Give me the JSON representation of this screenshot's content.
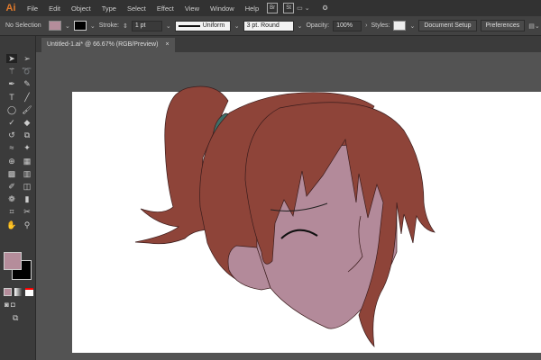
{
  "app": {
    "logo": "Ai",
    "menus": [
      "File",
      "Edit",
      "Object",
      "Type",
      "Select",
      "Effect",
      "View",
      "Window",
      "Help"
    ],
    "bridge": "Br",
    "stock": "St"
  },
  "control": {
    "selection": "No Selection",
    "fill_color": "#b58d9b",
    "stroke_label": "Stroke:",
    "stroke_weight": "1 pt",
    "profile": "Uniform",
    "brush": "3 pt. Round",
    "opacity_label": "Opacity:",
    "opacity": "100%",
    "styles_label": "Styles:",
    "document_setup": "Document Setup",
    "preferences": "Preferences"
  },
  "document": {
    "tab_title": "Untitled-1.ai* @ 66.67% (RGB/Preview)",
    "close": "×"
  },
  "colors": {
    "hair": "#8e4439",
    "skin": "#b38a9a",
    "band": "#3e6e68",
    "outline": "#3a1c1c"
  },
  "tools": [
    "selection",
    "direct-selection",
    "magic-wand",
    "lasso",
    "pen",
    "curvature",
    "type",
    "line",
    "ellipse",
    "paintbrush",
    "shaper",
    "eraser",
    "rotate",
    "scale",
    "warp",
    "puppet-warp",
    "shape-builder",
    "perspective",
    "mesh",
    "gradient",
    "eyedropper",
    "blend",
    "symbol-sprayer",
    "column-graph",
    "artboard",
    "slice",
    "hand",
    "zoom"
  ]
}
